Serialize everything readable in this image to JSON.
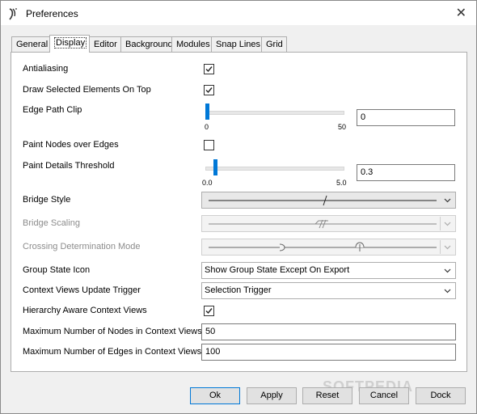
{
  "window": {
    "title": "Preferences",
    "close_icon": "close-icon",
    "app_icon": "app-logo-icon"
  },
  "tabs": [
    {
      "label": "General"
    },
    {
      "label": "Display"
    },
    {
      "label": "Editor"
    },
    {
      "label": "Background"
    },
    {
      "label": "Modules"
    },
    {
      "label": "Snap Lines"
    },
    {
      "label": "Grid"
    }
  ],
  "active_tab": "Display",
  "display": {
    "antialiasing": {
      "label": "Antialiasing",
      "checked": true
    },
    "draw_selected_on_top": {
      "label": "Draw Selected Elements On Top",
      "checked": true
    },
    "edge_path_clip": {
      "label": "Edge Path Clip",
      "min_label": "0",
      "max_label": "50",
      "value": "0",
      "level": 0
    },
    "paint_nodes_over_edges": {
      "label": "Paint Nodes over Edges",
      "checked": false
    },
    "paint_details_threshold": {
      "label": "Paint Details Threshold",
      "min_label": "0.0",
      "max_label": "5.0",
      "value": "0.3",
      "level": 0.06
    },
    "bridge_style": {
      "label": "Bridge Style"
    },
    "bridge_scaling": {
      "label": "Bridge Scaling",
      "disabled": true
    },
    "crossing_determination_mode": {
      "label": "Crossing Determination Mode",
      "disabled": true
    },
    "group_state_icon": {
      "label": "Group State Icon",
      "value": "Show Group State Except On Export"
    },
    "context_views_update_trigger": {
      "label": "Context Views Update Trigger",
      "value": "Selection Trigger"
    },
    "hierarchy_aware_context_views": {
      "label": "Hierarchy Aware Context Views",
      "checked": true
    },
    "max_nodes_context": {
      "label": "Maximum Number of Nodes in Context Views",
      "value": "50"
    },
    "max_edges_context": {
      "label": "Maximum Number of Edges in Context Views",
      "value": "100"
    }
  },
  "buttons": {
    "ok": "Ok",
    "apply": "Apply",
    "reset": "Reset",
    "cancel": "Cancel",
    "dock": "Dock"
  },
  "watermark": "SOFTPEDIA",
  "colors": {
    "accent": "#0078d7"
  }
}
